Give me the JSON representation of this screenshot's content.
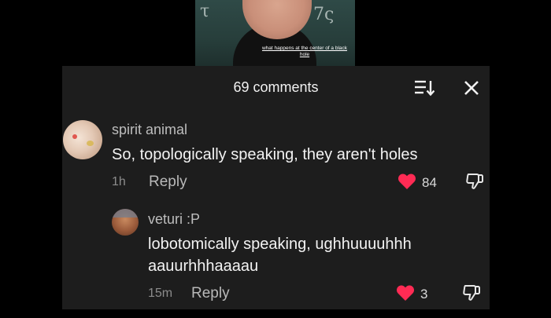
{
  "video": {
    "caption": "what happens at the center of a black hole",
    "board_left": "τ",
    "board_right": "7ς"
  },
  "header": {
    "comment_count": "69 comments",
    "sort_icon": "sort-icon",
    "close_icon": "close-icon"
  },
  "comments": [
    {
      "username": "spirit animal",
      "text": "So, topologically speaking, they aren't holes",
      "time": "1h",
      "reply_label": "Reply",
      "likes": "84",
      "liked": true
    },
    {
      "username": "veturi :P",
      "text": "lobotomically speaking, ughhuuuuhhh aauurhhhaaaau",
      "time": "15m",
      "reply_label": "Reply",
      "likes": "3",
      "liked": true
    }
  ],
  "colors": {
    "panel_bg": "#1d1d1d",
    "like_red": "#ff2b54"
  }
}
